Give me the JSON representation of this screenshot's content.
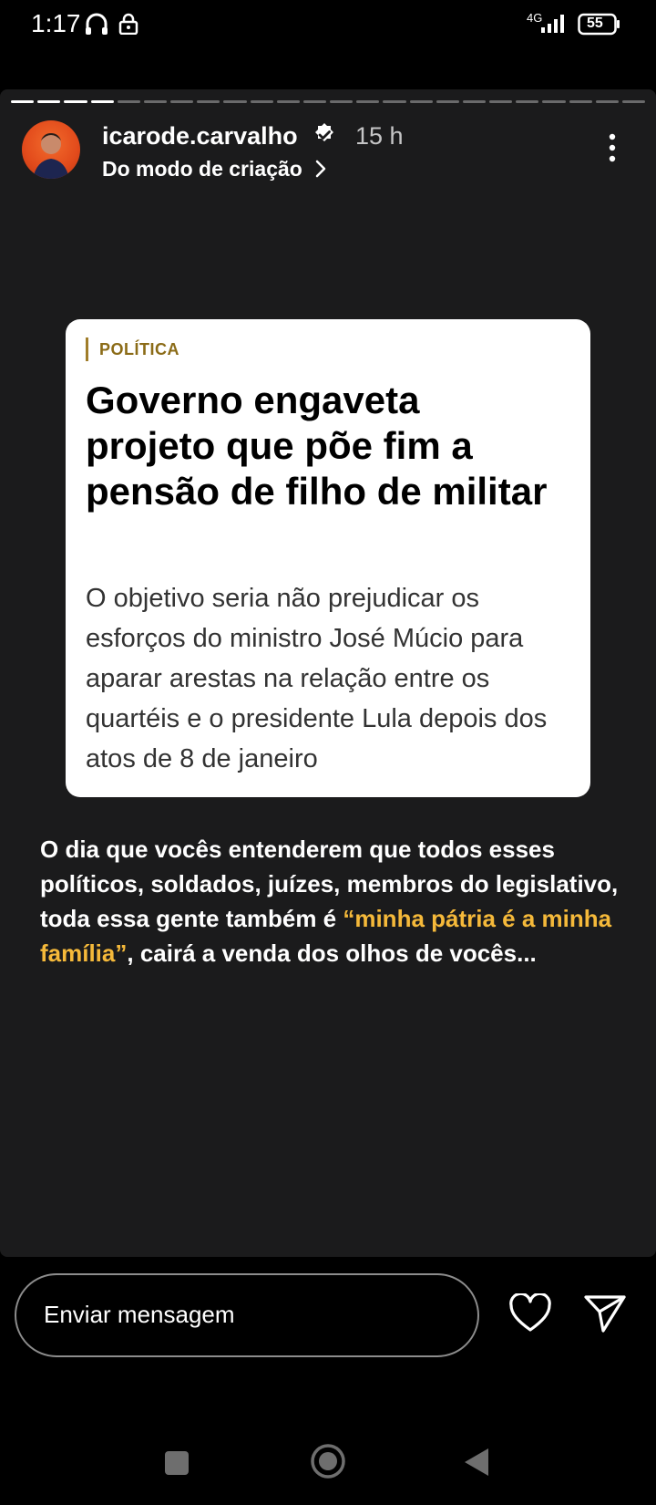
{
  "status": {
    "time": "1:17",
    "network": "4G",
    "battery": "55"
  },
  "story": {
    "progress": {
      "total_segments": 24,
      "viewed": 4
    },
    "username": "icarode.carvalho",
    "time_ago": "15 h",
    "subtitle": "Do modo de criação",
    "icons": {
      "verified": "verified-badge-icon",
      "chevron": "chevron-right-icon",
      "more": "more-vertical-icon"
    }
  },
  "card": {
    "kicker": "POLÍTICA",
    "headline": "Governo engaveta projeto que põe fim a pensão de filho de militar",
    "summary": "O objetivo seria não prejudicar os esforços do ministro José Múcio para aparar arestas na relação entre os quartéis e o presidente Lula depois dos atos de 8 de janeiro"
  },
  "caption": {
    "part1": "O dia que vocês entenderem que todos esses políticos, soldados, juízes, membros do legislativo, toda essa gente também é ",
    "highlight": "“minha pátria é a minha família”",
    "part2": ", cairá a venda dos olhos de vocês..."
  },
  "footer": {
    "message_placeholder": "Enviar mensagem"
  },
  "colors": {
    "highlight": "#f5b93a",
    "kicker": "#8b6b17",
    "story_bg": "#1b1b1c"
  }
}
